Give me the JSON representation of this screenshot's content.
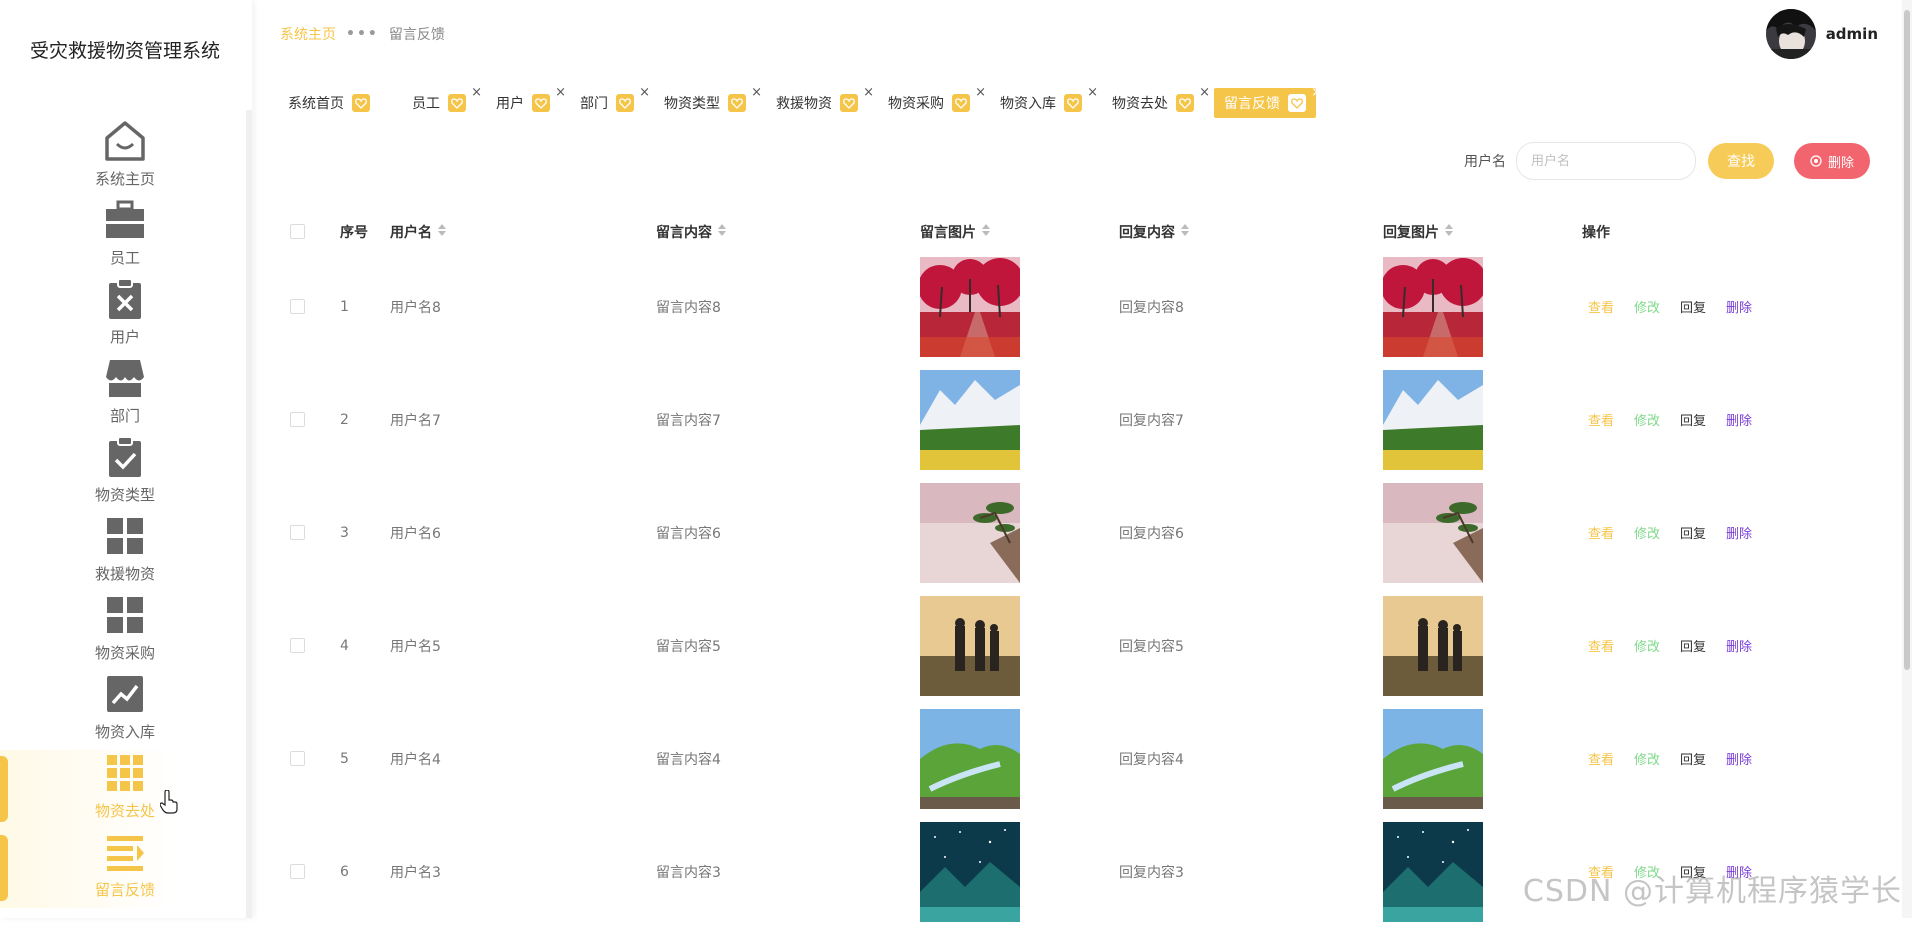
{
  "app": {
    "title": "受灾救援物资管理系统"
  },
  "sidebar": {
    "items": [
      {
        "label": "系统主页",
        "icon": "home-icon"
      },
      {
        "label": "员工",
        "icon": "briefcase-icon"
      },
      {
        "label": "用户",
        "icon": "clipboard-x-icon"
      },
      {
        "label": "部门",
        "icon": "store-icon"
      },
      {
        "label": "物资类型",
        "icon": "clipboard-check-icon"
      },
      {
        "label": "救援物资",
        "icon": "grid-icon"
      },
      {
        "label": "物资采购",
        "icon": "grid-icon"
      },
      {
        "label": "物资入库",
        "icon": "trend-chart-icon"
      },
      {
        "label": "物资去处",
        "icon": "apps-icon"
      },
      {
        "label": "留言反馈",
        "icon": "list-indent-icon"
      }
    ]
  },
  "header": {
    "breadcrumb": {
      "home": "系统主页",
      "current": "留言反馈"
    },
    "username": "admin"
  },
  "tabs": [
    {
      "label": "系统首页",
      "closable": false
    },
    {
      "label": "员工",
      "closable": true
    },
    {
      "label": "用户",
      "closable": true
    },
    {
      "label": "部门",
      "closable": true
    },
    {
      "label": "物资类型",
      "closable": true
    },
    {
      "label": "救援物资",
      "closable": true
    },
    {
      "label": "物资采购",
      "closable": true
    },
    {
      "label": "物资入库",
      "closable": true
    },
    {
      "label": "物资去处",
      "closable": true
    },
    {
      "label": "留言反馈",
      "closable": true,
      "active": true
    }
  ],
  "search": {
    "label": "用户名",
    "placeholder": "用户名",
    "search_button": "查找",
    "delete_button": "删除"
  },
  "table": {
    "headers": {
      "index": "序号",
      "username": "用户名",
      "content": "留言内容",
      "image": "留言图片",
      "reply": "回复内容",
      "reply_image": "回复图片",
      "actions": "操作"
    },
    "actions": {
      "view": "查看",
      "edit": "修改",
      "reply": "回复",
      "delete": "删除"
    },
    "rows": [
      {
        "index": "1",
        "username": "用户名8",
        "content": "留言内容8",
        "reply": "回复内容8",
        "image": "red-autumn-trees-path"
      },
      {
        "index": "2",
        "username": "用户名7",
        "content": "留言内容7",
        "reply": "回复内容7",
        "image": "snowy-mountain-meadow"
      },
      {
        "index": "3",
        "username": "用户名6",
        "content": "留言内容6",
        "reply": "回复内容6",
        "image": "pine-tree-sea-of-clouds"
      },
      {
        "index": "4",
        "username": "用户名5",
        "content": "留言内容5",
        "reply": "回复内容5",
        "image": "hikers-at-sunset"
      },
      {
        "index": "5",
        "username": "用户名4",
        "content": "留言内容4",
        "reply": "回复内容4",
        "image": "green-valley-stream"
      },
      {
        "index": "6",
        "username": "用户名3",
        "content": "留言内容3",
        "reply": "回复内容3",
        "image": "starry-night-lake"
      }
    ]
  },
  "watermark": "CSDN @计算机程序猿学长",
  "colors": {
    "accent": "#f5c54a",
    "danger": "#f2646e",
    "edit": "#7fd98a",
    "delete_link": "#7a3cd6"
  }
}
